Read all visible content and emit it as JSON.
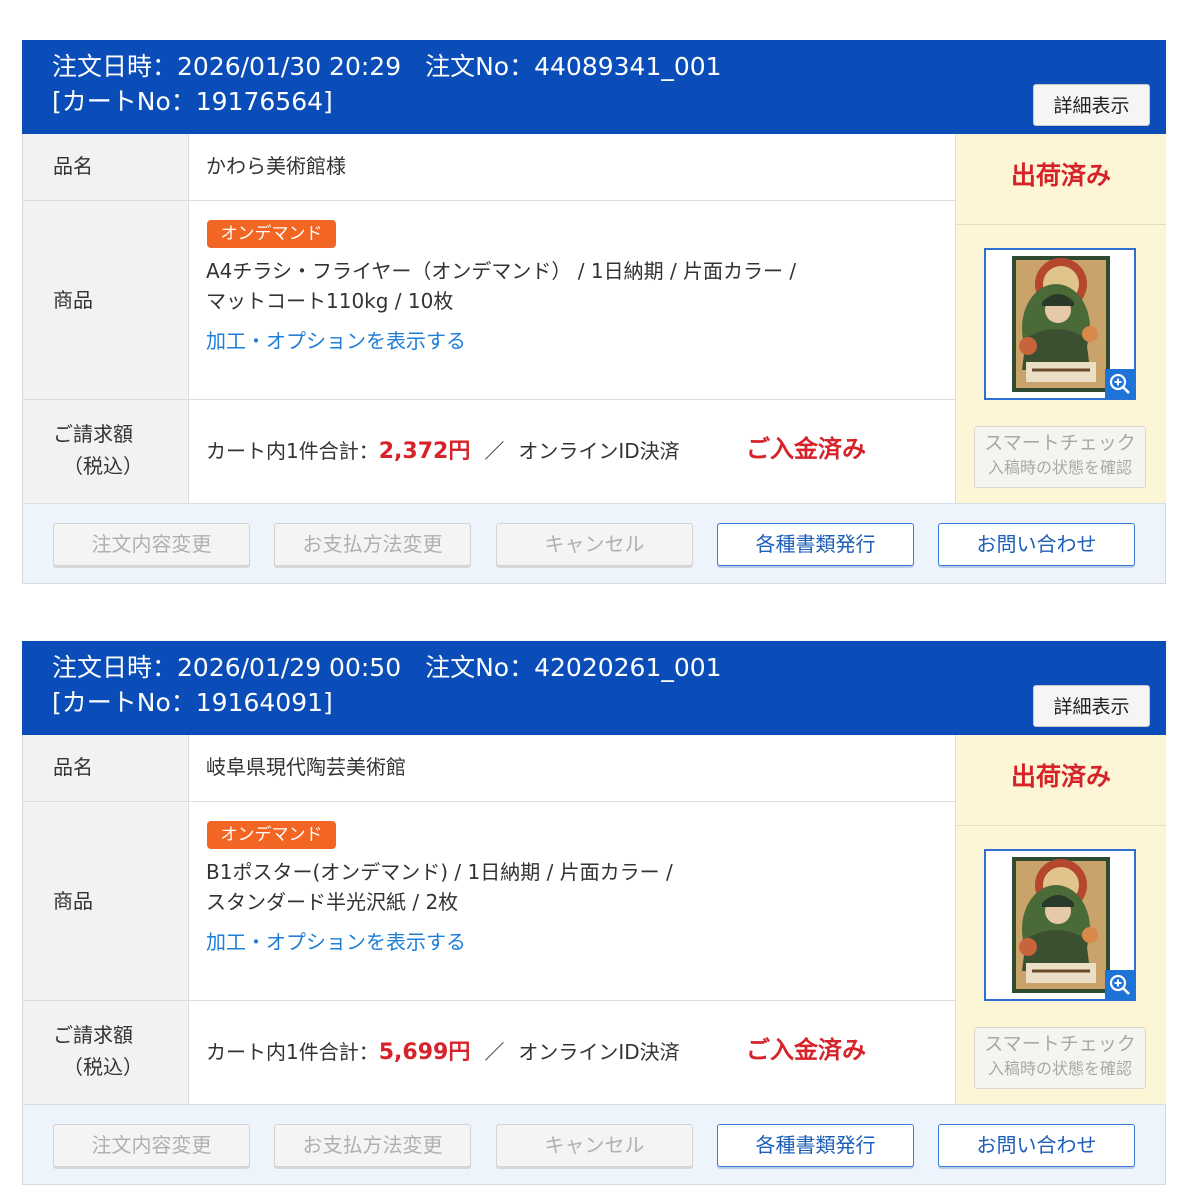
{
  "labels": {
    "order_date": "注文日時：",
    "order_no": "注文No：",
    "cart_no_prefix": "[カートNo：",
    "cart_no_suffix": "]",
    "product_name": "品名",
    "product": "商品",
    "billing_line1": "ご請求額",
    "billing_line2": "（税込）",
    "cart_total": "カート内1件合計：",
    "yen": "円",
    "slash": "／",
    "payment_method": "オンラインID決済",
    "payment_status": "ご入金済み",
    "detail_button": "詳細表示",
    "option_link": "加工・オプションを表示する",
    "smart_check_line1": "スマートチェック",
    "smart_check_line2": "入稿時の状態を確認",
    "action_buttons": [
      "注文内容変更",
      "お支払方法変更",
      "キャンセル",
      "各種書類発行",
      "お問い合わせ"
    ],
    "action_enabled": [
      false,
      false,
      false,
      true,
      true
    ]
  },
  "orders": [
    {
      "datetime": "2026/01/30 20:29",
      "order_no": "44089341_001",
      "cart_no": "19176564",
      "product_name": "かわら美術館様",
      "badge": "オンデマンド",
      "product_line1": "A4チラシ・フライヤー（オンデマンド） / 1日納期 / 片面カラー /",
      "product_line2": "マットコート110kg / 10枚",
      "price": "2,372",
      "status": "出荷済み"
    },
    {
      "datetime": "2026/01/29 00:50",
      "order_no": "42020261_001",
      "cart_no": "19164091",
      "product_name": "岐阜県現代陶芸美術館",
      "badge": "オンデマンド",
      "product_line1": "B1ポスター(オンデマンド) / 1日納期 / 片面カラー /",
      "product_line2": "スタンダード半光沢紙 / 2枚",
      "price": "5,699",
      "status": "出荷済み"
    }
  ]
}
